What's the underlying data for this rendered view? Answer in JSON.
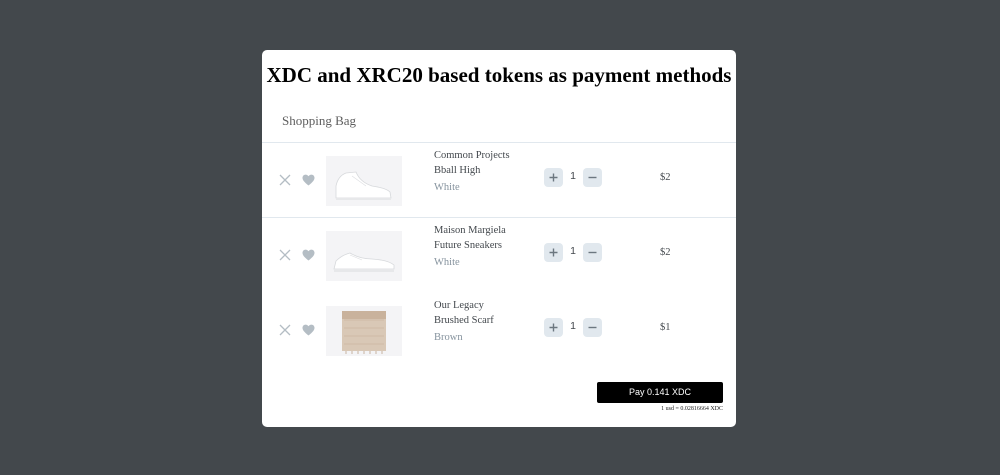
{
  "header": {
    "title": "XDC and XRC20 based tokens as payment methods",
    "bag_title": "Shopping Bag"
  },
  "colors": {
    "backdrop": "#43484c",
    "card": "#ffffff",
    "qty_button_bg": "#e1e8ee",
    "icon_gray": "#b4bdc4",
    "pay_button_bg": "#000000"
  },
  "items": [
    {
      "name": "Common Projects",
      "sub": "Bball High",
      "color": "White",
      "quantity": "1",
      "price": "$2",
      "image": "white-high-top-sneaker"
    },
    {
      "name": "Maison Margiela",
      "sub": "Future Sneakers",
      "color": "White",
      "quantity": "1",
      "price": "$2",
      "image": "white-low-sneaker"
    },
    {
      "name": "Our Legacy",
      "sub": "Brushed Scarf",
      "color": "Brown",
      "quantity": "1",
      "price": "$1",
      "image": "brown-scarf"
    }
  ],
  "icons": {
    "remove": "close-icon",
    "favorite": "heart-icon",
    "increase": "plus-icon",
    "decrease": "minus-icon"
  },
  "checkout": {
    "pay_label": "Pay 0.141 XDC",
    "rate_text": "1 usd = 0.02816664 XDC"
  }
}
